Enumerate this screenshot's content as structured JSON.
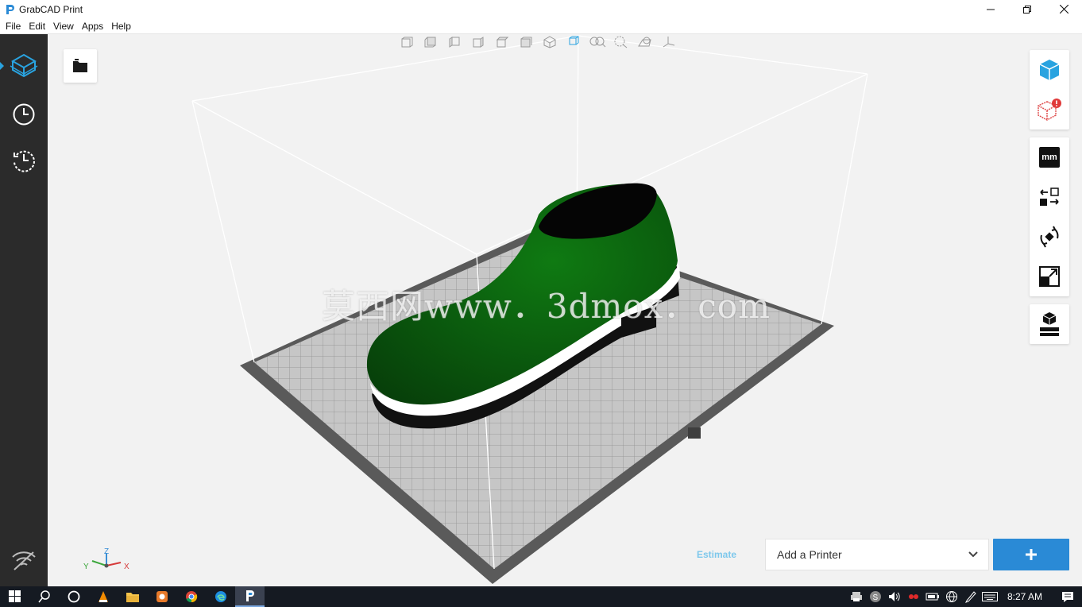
{
  "window": {
    "title": "GrabCAD Print"
  },
  "menu": [
    "File",
    "Edit",
    "View",
    "Apps",
    "Help"
  ],
  "sidebar": {
    "items": [
      {
        "name": "prepare-model-icon",
        "active": true
      },
      {
        "name": "print-queue-clock-icon",
        "active": false
      },
      {
        "name": "print-history-icon",
        "active": false
      },
      {
        "name": "wifi-off-icon",
        "active": false
      }
    ]
  },
  "viewport": {
    "view_toolbar_icons": [
      "view-front-icon",
      "view-back-icon",
      "view-left-icon",
      "view-right-icon",
      "view-top-icon",
      "view-bottom-icon",
      "view-iso-icon",
      "view-perspective-icon",
      "zoom-fit-icon",
      "zoom-selection-icon",
      "shadow-icon",
      "axis-icon"
    ],
    "right_panel_icons": [
      "model-view-cube-icon",
      "model-warning-cube-icon",
      "units-mm-icon",
      "move-icon",
      "rotate-icon",
      "scale-icon",
      "printer-settings-icon"
    ],
    "units_label": "mm",
    "watermark": "莫西网www．3dmox．com",
    "axis_labels": {
      "x": "X",
      "y": "Y",
      "z": "Z"
    },
    "colors": {
      "shoe": "#0b5a0b",
      "sole_white": "#ffffff",
      "sole_black": "#111111",
      "bed": "#c8c8c8",
      "bed_frame": "#5a5a5a",
      "accent": "#2a8ad6"
    }
  },
  "bottom": {
    "estimate_label": "Estimate",
    "printer_select_value": "Add a Printer",
    "add_button_label": "+"
  },
  "taskbar": {
    "clock": "8:27 AM",
    "apps": [
      "windows-start-icon",
      "search-icon",
      "cortana-icon",
      "vlc-icon",
      "file-explorer-icon",
      "app-orange-icon",
      "chrome-icon",
      "edge-icon",
      "grabcad-print-icon"
    ],
    "tray": [
      "printer-tray-icon",
      "skype-icon",
      "volume-icon",
      "app-red-icon",
      "battery-icon",
      "network-icon",
      "pen-icon",
      "keyboard-icon"
    ]
  }
}
